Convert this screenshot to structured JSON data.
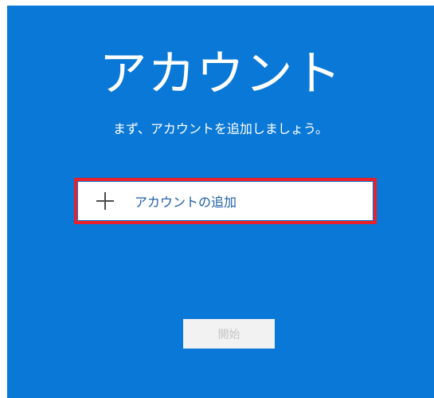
{
  "window": {
    "title": "アカウント",
    "subtitle": "まず、アカウントを追加しましょう。"
  },
  "add_account": {
    "label": "アカウントの追加",
    "icon": "plus-icon"
  },
  "start_button": {
    "label": "開始",
    "enabled": false
  },
  "colors": {
    "background": "#0a78d6",
    "highlight": "#e8212b",
    "link_text": "#1d5fa8"
  }
}
